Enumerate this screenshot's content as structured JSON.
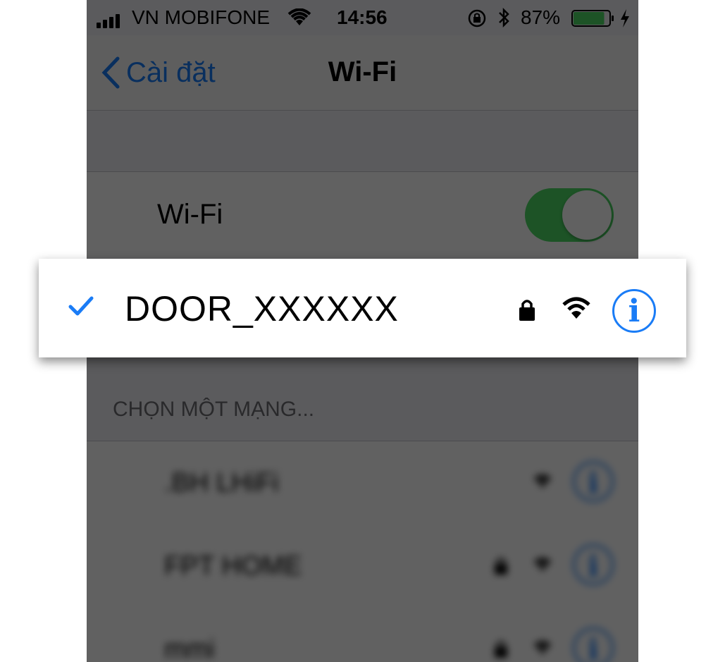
{
  "status_bar": {
    "carrier": "VN MOBIFONE",
    "time": "14:56",
    "battery": "87%",
    "battery_level": 0.87
  },
  "nav": {
    "back_label": "Cài đặt",
    "title": "Wi-Fi"
  },
  "wifi_toggle": {
    "label": "Wi-Fi",
    "on": true
  },
  "connected_network": {
    "name": "DOOR_XXXXXX",
    "secured": true
  },
  "choose_network": {
    "header": "CHỌN MỘT MẠNG...",
    "networks": [
      {
        "name": ".BH LHiFi"
      },
      {
        "name": "FPT HOME"
      },
      {
        "name": "mmi"
      }
    ]
  },
  "colors": {
    "accent": "#1a7cf6",
    "toggle_on": "#4cd964",
    "battery": "#4cd964"
  }
}
